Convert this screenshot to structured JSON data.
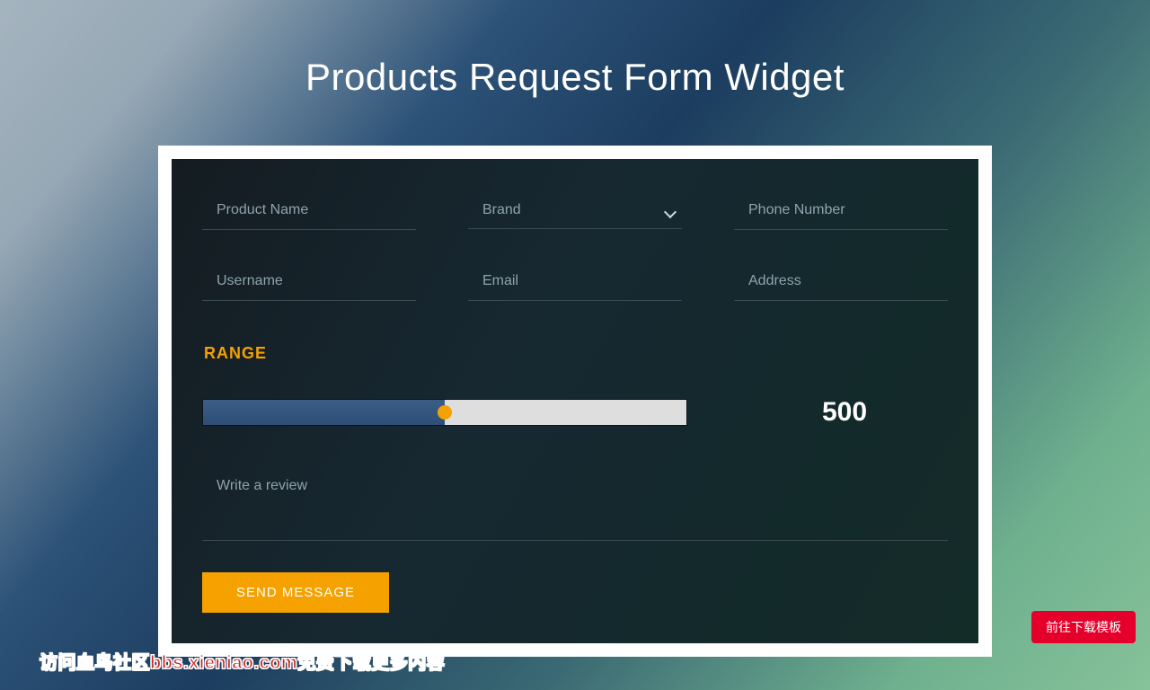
{
  "page": {
    "title": "Products Request Form Widget"
  },
  "form": {
    "product_name": {
      "placeholder": "Product Name"
    },
    "brand": {
      "selected": "Brand"
    },
    "phone": {
      "placeholder": "Phone Number"
    },
    "username": {
      "placeholder": "Username"
    },
    "email": {
      "placeholder": "Email"
    },
    "address": {
      "placeholder": "Address"
    },
    "range": {
      "label": "RANGE",
      "value": "500",
      "percent": 50
    },
    "review": {
      "placeholder": "Write a review"
    },
    "submit": {
      "label": "SEND MESSAGE"
    }
  },
  "floating": {
    "download_button": "前往下载模板",
    "watermark": "访问血鸟社区bbs.xieniao.com免费下载更多内容"
  }
}
